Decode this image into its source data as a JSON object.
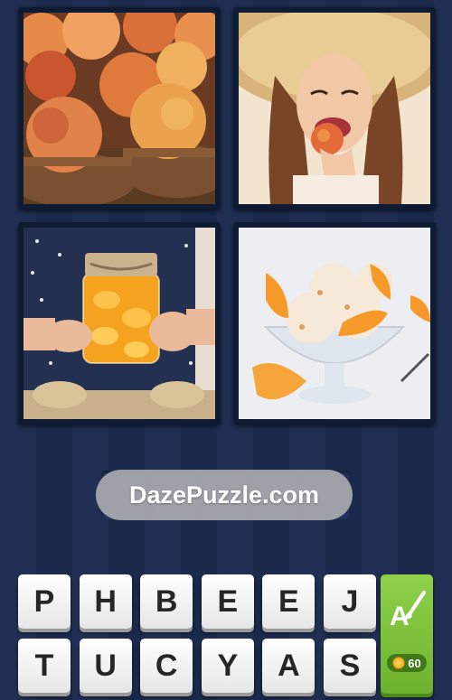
{
  "tiles": [
    {
      "subject": "peaches-in-baskets"
    },
    {
      "subject": "woman-eating-peach"
    },
    {
      "subject": "jar-of-canned-peaches"
    },
    {
      "subject": "ice-cream-with-peach-slices"
    }
  ],
  "answer": {
    "slot_count": 5
  },
  "watermark": "DazePuzzle.com",
  "letters": [
    "P",
    "H",
    "B",
    "E",
    "E",
    "J",
    "T",
    "U",
    "C",
    "Y",
    "A",
    "S"
  ],
  "hint": {
    "icon": "paint-brush-letter-a-icon",
    "cost": "60",
    "coin_icon": "coin-icon"
  },
  "colors": {
    "background": "#1b2a4f",
    "hint_green": "#7cc23a",
    "tile_white": "#f2f2f2"
  }
}
